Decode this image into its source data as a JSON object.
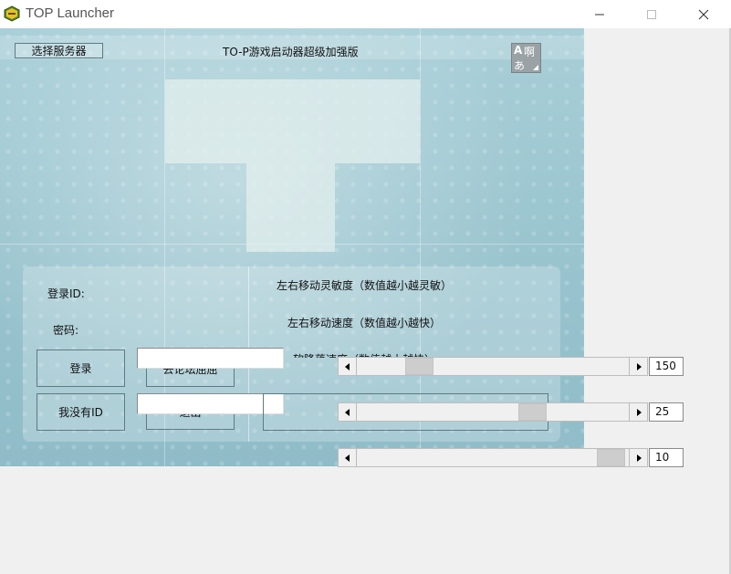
{
  "window": {
    "title": "TOP Launcher",
    "minimize_icon": "minimize-icon",
    "maximize_icon": "maximize-icon",
    "close_icon": "close-icon",
    "app_icon": "top-launcher-icon"
  },
  "header": {
    "server_button": "选择服务器",
    "app_title": "TO-P游戏启动器超级加强版",
    "ime": {
      "a": "A",
      "w": "啊",
      "h": "あ"
    }
  },
  "login": {
    "id_label": "登录ID:",
    "password_label": "密码:",
    "id_value": "",
    "password_value": "",
    "login_button": "登录",
    "no_id_button": "我没有ID",
    "forum_button": "去论坛屈屈",
    "exit_button": "退出"
  },
  "settings": {
    "move_sensitivity_label": "左右移动灵敏度（数值越小越灵敏）",
    "move_speed_label": "左右移动速度（数值越小越快）",
    "soft_drop_label": "软降落速度（数值越小越快）",
    "slider_move_sensitivity": {
      "value": 150,
      "position_fraction": 0.2
    },
    "slider_move_speed": {
      "value": 25,
      "position_fraction": 0.663
    },
    "slider_soft_drop": {
      "value": 10,
      "position_fraction": 0.98
    }
  },
  "colors": {
    "background_teal": "#9cc6d0",
    "window_bg": "#f0f0f0"
  }
}
